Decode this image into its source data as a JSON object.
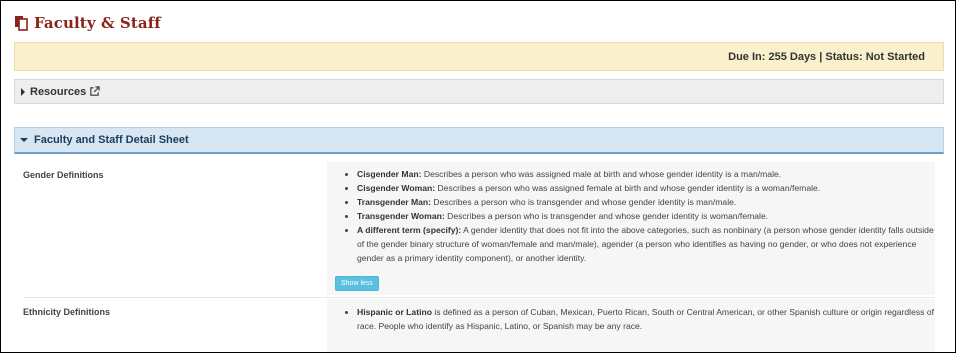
{
  "header": {
    "title": "Faculty & Staff",
    "icon": "copy-document-icon"
  },
  "status_bar": {
    "text": "Due In: 255 Days | Status: Not Started"
  },
  "resources": {
    "label": "Resources",
    "icon": "external-link-icon"
  },
  "section": {
    "label": "Faculty and Staff Detail Sheet"
  },
  "gender": {
    "label": "Gender Definitions",
    "items": [
      {
        "term": "Cisgender Man:",
        "desc": " Describes a person who was assigned male at birth and whose gender identity is a man/male."
      },
      {
        "term": "Cisgender Woman:",
        "desc": " Describes a person who was assigned female at birth and whose gender identity is a woman/female."
      },
      {
        "term": "Transgender Man:",
        "desc": " Describes a person who is transgender and whose gender identity is man/male."
      },
      {
        "term": "Transgender Woman:",
        "desc": " Describes a person who is transgender and whose gender identity is woman/female."
      },
      {
        "term": "A different term (specify):",
        "desc": " A gender identity that does not fit into the above categories, such as nonbinary (a person whose gender identity falls outside of the gender binary structure of woman/female and man/male), agender (a person who identifies as having no gender, or who does not experience gender as a primary identity component), or another identity."
      }
    ],
    "show_less_label": "Show less"
  },
  "ethnicity": {
    "label": "Ethnicity Definitions",
    "items": [
      {
        "term": "Hispanic or Latino",
        "desc": " is defined as a person of Cuban, Mexican, Puerto Rican, South or Central American, or other Spanish culture or origin regardless of race. People who identify as Hispanic, Latino, or Spanish may be any race."
      }
    ]
  },
  "colors": {
    "title": "#8b2318",
    "status_bg": "#fbf0cc",
    "section_bg": "#d6e6f3",
    "button": "#5bc0de"
  }
}
